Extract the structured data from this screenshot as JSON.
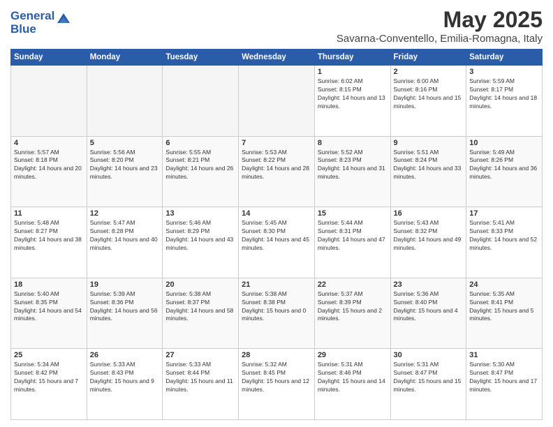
{
  "header": {
    "logo_line1": "General",
    "logo_line2": "Blue",
    "month": "May 2025",
    "location": "Savarna-Conventello, Emilia-Romagna, Italy"
  },
  "days_of_week": [
    "Sunday",
    "Monday",
    "Tuesday",
    "Wednesday",
    "Thursday",
    "Friday",
    "Saturday"
  ],
  "weeks": [
    [
      {
        "day": "",
        "empty": true
      },
      {
        "day": "",
        "empty": true
      },
      {
        "day": "",
        "empty": true
      },
      {
        "day": "",
        "empty": true
      },
      {
        "day": "1",
        "sunrise": "Sunrise: 6:02 AM",
        "sunset": "Sunset: 8:15 PM",
        "daylight": "Daylight: 14 hours and 13 minutes."
      },
      {
        "day": "2",
        "sunrise": "Sunrise: 6:00 AM",
        "sunset": "Sunset: 8:16 PM",
        "daylight": "Daylight: 14 hours and 15 minutes."
      },
      {
        "day": "3",
        "sunrise": "Sunrise: 5:59 AM",
        "sunset": "Sunset: 8:17 PM",
        "daylight": "Daylight: 14 hours and 18 minutes."
      }
    ],
    [
      {
        "day": "4",
        "sunrise": "Sunrise: 5:57 AM",
        "sunset": "Sunset: 8:18 PM",
        "daylight": "Daylight: 14 hours and 20 minutes."
      },
      {
        "day": "5",
        "sunrise": "Sunrise: 5:56 AM",
        "sunset": "Sunset: 8:20 PM",
        "daylight": "Daylight: 14 hours and 23 minutes."
      },
      {
        "day": "6",
        "sunrise": "Sunrise: 5:55 AM",
        "sunset": "Sunset: 8:21 PM",
        "daylight": "Daylight: 14 hours and 26 minutes."
      },
      {
        "day": "7",
        "sunrise": "Sunrise: 5:53 AM",
        "sunset": "Sunset: 8:22 PM",
        "daylight": "Daylight: 14 hours and 28 minutes."
      },
      {
        "day": "8",
        "sunrise": "Sunrise: 5:52 AM",
        "sunset": "Sunset: 8:23 PM",
        "daylight": "Daylight: 14 hours and 31 minutes."
      },
      {
        "day": "9",
        "sunrise": "Sunrise: 5:51 AM",
        "sunset": "Sunset: 8:24 PM",
        "daylight": "Daylight: 14 hours and 33 minutes."
      },
      {
        "day": "10",
        "sunrise": "Sunrise: 5:49 AM",
        "sunset": "Sunset: 8:26 PM",
        "daylight": "Daylight: 14 hours and 36 minutes."
      }
    ],
    [
      {
        "day": "11",
        "sunrise": "Sunrise: 5:48 AM",
        "sunset": "Sunset: 8:27 PM",
        "daylight": "Daylight: 14 hours and 38 minutes."
      },
      {
        "day": "12",
        "sunrise": "Sunrise: 5:47 AM",
        "sunset": "Sunset: 8:28 PM",
        "daylight": "Daylight: 14 hours and 40 minutes."
      },
      {
        "day": "13",
        "sunrise": "Sunrise: 5:46 AM",
        "sunset": "Sunset: 8:29 PM",
        "daylight": "Daylight: 14 hours and 43 minutes."
      },
      {
        "day": "14",
        "sunrise": "Sunrise: 5:45 AM",
        "sunset": "Sunset: 8:30 PM",
        "daylight": "Daylight: 14 hours and 45 minutes."
      },
      {
        "day": "15",
        "sunrise": "Sunrise: 5:44 AM",
        "sunset": "Sunset: 8:31 PM",
        "daylight": "Daylight: 14 hours and 47 minutes."
      },
      {
        "day": "16",
        "sunrise": "Sunrise: 5:43 AM",
        "sunset": "Sunset: 8:32 PM",
        "daylight": "Daylight: 14 hours and 49 minutes."
      },
      {
        "day": "17",
        "sunrise": "Sunrise: 5:41 AM",
        "sunset": "Sunset: 8:33 PM",
        "daylight": "Daylight: 14 hours and 52 minutes."
      }
    ],
    [
      {
        "day": "18",
        "sunrise": "Sunrise: 5:40 AM",
        "sunset": "Sunset: 8:35 PM",
        "daylight": "Daylight: 14 hours and 54 minutes."
      },
      {
        "day": "19",
        "sunrise": "Sunrise: 5:39 AM",
        "sunset": "Sunset: 8:36 PM",
        "daylight": "Daylight: 14 hours and 56 minutes."
      },
      {
        "day": "20",
        "sunrise": "Sunrise: 5:38 AM",
        "sunset": "Sunset: 8:37 PM",
        "daylight": "Daylight: 14 hours and 58 minutes."
      },
      {
        "day": "21",
        "sunrise": "Sunrise: 5:38 AM",
        "sunset": "Sunset: 8:38 PM",
        "daylight": "Daylight: 15 hours and 0 minutes."
      },
      {
        "day": "22",
        "sunrise": "Sunrise: 5:37 AM",
        "sunset": "Sunset: 8:39 PM",
        "daylight": "Daylight: 15 hours and 2 minutes."
      },
      {
        "day": "23",
        "sunrise": "Sunrise: 5:36 AM",
        "sunset": "Sunset: 8:40 PM",
        "daylight": "Daylight: 15 hours and 4 minutes."
      },
      {
        "day": "24",
        "sunrise": "Sunrise: 5:35 AM",
        "sunset": "Sunset: 8:41 PM",
        "daylight": "Daylight: 15 hours and 5 minutes."
      }
    ],
    [
      {
        "day": "25",
        "sunrise": "Sunrise: 5:34 AM",
        "sunset": "Sunset: 8:42 PM",
        "daylight": "Daylight: 15 hours and 7 minutes."
      },
      {
        "day": "26",
        "sunrise": "Sunrise: 5:33 AM",
        "sunset": "Sunset: 8:43 PM",
        "daylight": "Daylight: 15 hours and 9 minutes."
      },
      {
        "day": "27",
        "sunrise": "Sunrise: 5:33 AM",
        "sunset": "Sunset: 8:44 PM",
        "daylight": "Daylight: 15 hours and 11 minutes."
      },
      {
        "day": "28",
        "sunrise": "Sunrise: 5:32 AM",
        "sunset": "Sunset: 8:45 PM",
        "daylight": "Daylight: 15 hours and 12 minutes."
      },
      {
        "day": "29",
        "sunrise": "Sunrise: 5:31 AM",
        "sunset": "Sunset: 8:46 PM",
        "daylight": "Daylight: 15 hours and 14 minutes."
      },
      {
        "day": "30",
        "sunrise": "Sunrise: 5:31 AM",
        "sunset": "Sunset: 8:47 PM",
        "daylight": "Daylight: 15 hours and 15 minutes."
      },
      {
        "day": "31",
        "sunrise": "Sunrise: 5:30 AM",
        "sunset": "Sunset: 8:47 PM",
        "daylight": "Daylight: 15 hours and 17 minutes."
      }
    ]
  ]
}
